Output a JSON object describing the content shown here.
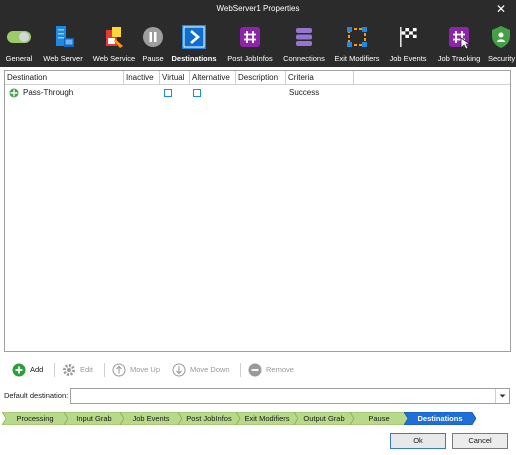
{
  "window": {
    "title": "WebServer1 Properties",
    "close_glyph": "✕"
  },
  "toolbar": {
    "items": [
      {
        "label": "General",
        "icon": "toggle-icon"
      },
      {
        "label": "Web Server",
        "icon": "server-icon"
      },
      {
        "label": "Web Service",
        "icon": "web-service-icon"
      },
      {
        "label": "Pause",
        "icon": "pause-icon"
      },
      {
        "label": "Destinations",
        "icon": "destinations-icon",
        "active": true
      },
      {
        "label": "Post JobInfos",
        "icon": "hash-icon"
      },
      {
        "label": "Connections",
        "icon": "database-icon"
      },
      {
        "label": "Exit Modifiers",
        "icon": "exit-modifiers-icon"
      },
      {
        "label": "Job Events",
        "icon": "checkered-flag-icon"
      },
      {
        "label": "Job Tracking",
        "icon": "hash-cursor-icon"
      },
      {
        "label": "Security",
        "icon": "shield-icon"
      }
    ]
  },
  "grid": {
    "columns": [
      "Destination",
      "Inactive",
      "Virtual",
      "Alternative",
      "Description",
      "Criteria"
    ],
    "rows": [
      {
        "destination": "Pass-Through",
        "inactive": "",
        "virtual": false,
        "alternative": false,
        "description": "",
        "criteria": "Success"
      }
    ]
  },
  "actions": {
    "add": "Add",
    "edit": "Edit",
    "move_up": "Move Up",
    "move_down": "Move Down",
    "remove": "Remove"
  },
  "default_destination": {
    "label": "Default destination:",
    "value": ""
  },
  "steps": {
    "items": [
      {
        "label": "Processing"
      },
      {
        "label": "Input Grab"
      },
      {
        "label": "Job Events"
      },
      {
        "label": "Post JobInfos"
      },
      {
        "label": "Exit Modifiers"
      },
      {
        "label": "Output Grab"
      },
      {
        "label": "Pause"
      },
      {
        "label": "Destinations",
        "active": true
      }
    ]
  },
  "buttons": {
    "ok": "Ok",
    "cancel": "Cancel"
  },
  "colors": {
    "dark_bg": "#2b2b2b",
    "step_green": "#b8d88a",
    "step_active": "#1e6fd8",
    "accent_blue": "#1e88e5",
    "add_green": "#2e9e3a"
  }
}
